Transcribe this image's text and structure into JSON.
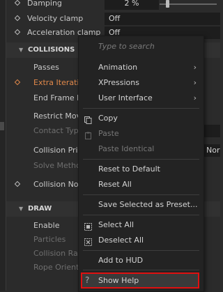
{
  "props_top": [
    {
      "label": "Damping",
      "value": "2 %"
    },
    {
      "label": "Velocity clamp",
      "value": "Off"
    },
    {
      "label": "Acceleration clamp",
      "value": "Off"
    }
  ],
  "sections": {
    "collisions": "COLLISIONS",
    "draw": "DRAW"
  },
  "collisions_props": [
    "Passes",
    "Extra Iteration",
    "End Frame P",
    "Restrict Mov",
    "Contact Type",
    "Collision Prio",
    "Solve Metho",
    "Collision No"
  ],
  "collision_prio_value": "Nor",
  "draw_props": [
    "Enable",
    "Particles",
    "Collision Rad",
    "Rope Orienta"
  ],
  "context_menu": {
    "search_placeholder": "Type to search",
    "items": {
      "animation": "Animation",
      "xpressions": "XPressions",
      "user_interface": "User Interface",
      "copy": "Copy",
      "paste": "Paste",
      "paste_identical": "Paste Identical",
      "reset_default": "Reset to Default",
      "reset_all": "Reset All",
      "save_preset": "Save Selected as Preset...",
      "select_all": "Select All",
      "deselect_all": "Deselect All",
      "add_hud": "Add to HUD",
      "show_help": "Show Help"
    },
    "submenu_arrow": "›"
  },
  "icons": {
    "help": "?",
    "section_triangle": "▼"
  },
  "colors": {
    "highlight_outline": "#e01010",
    "keyframe_orange": "#e0884a"
  }
}
